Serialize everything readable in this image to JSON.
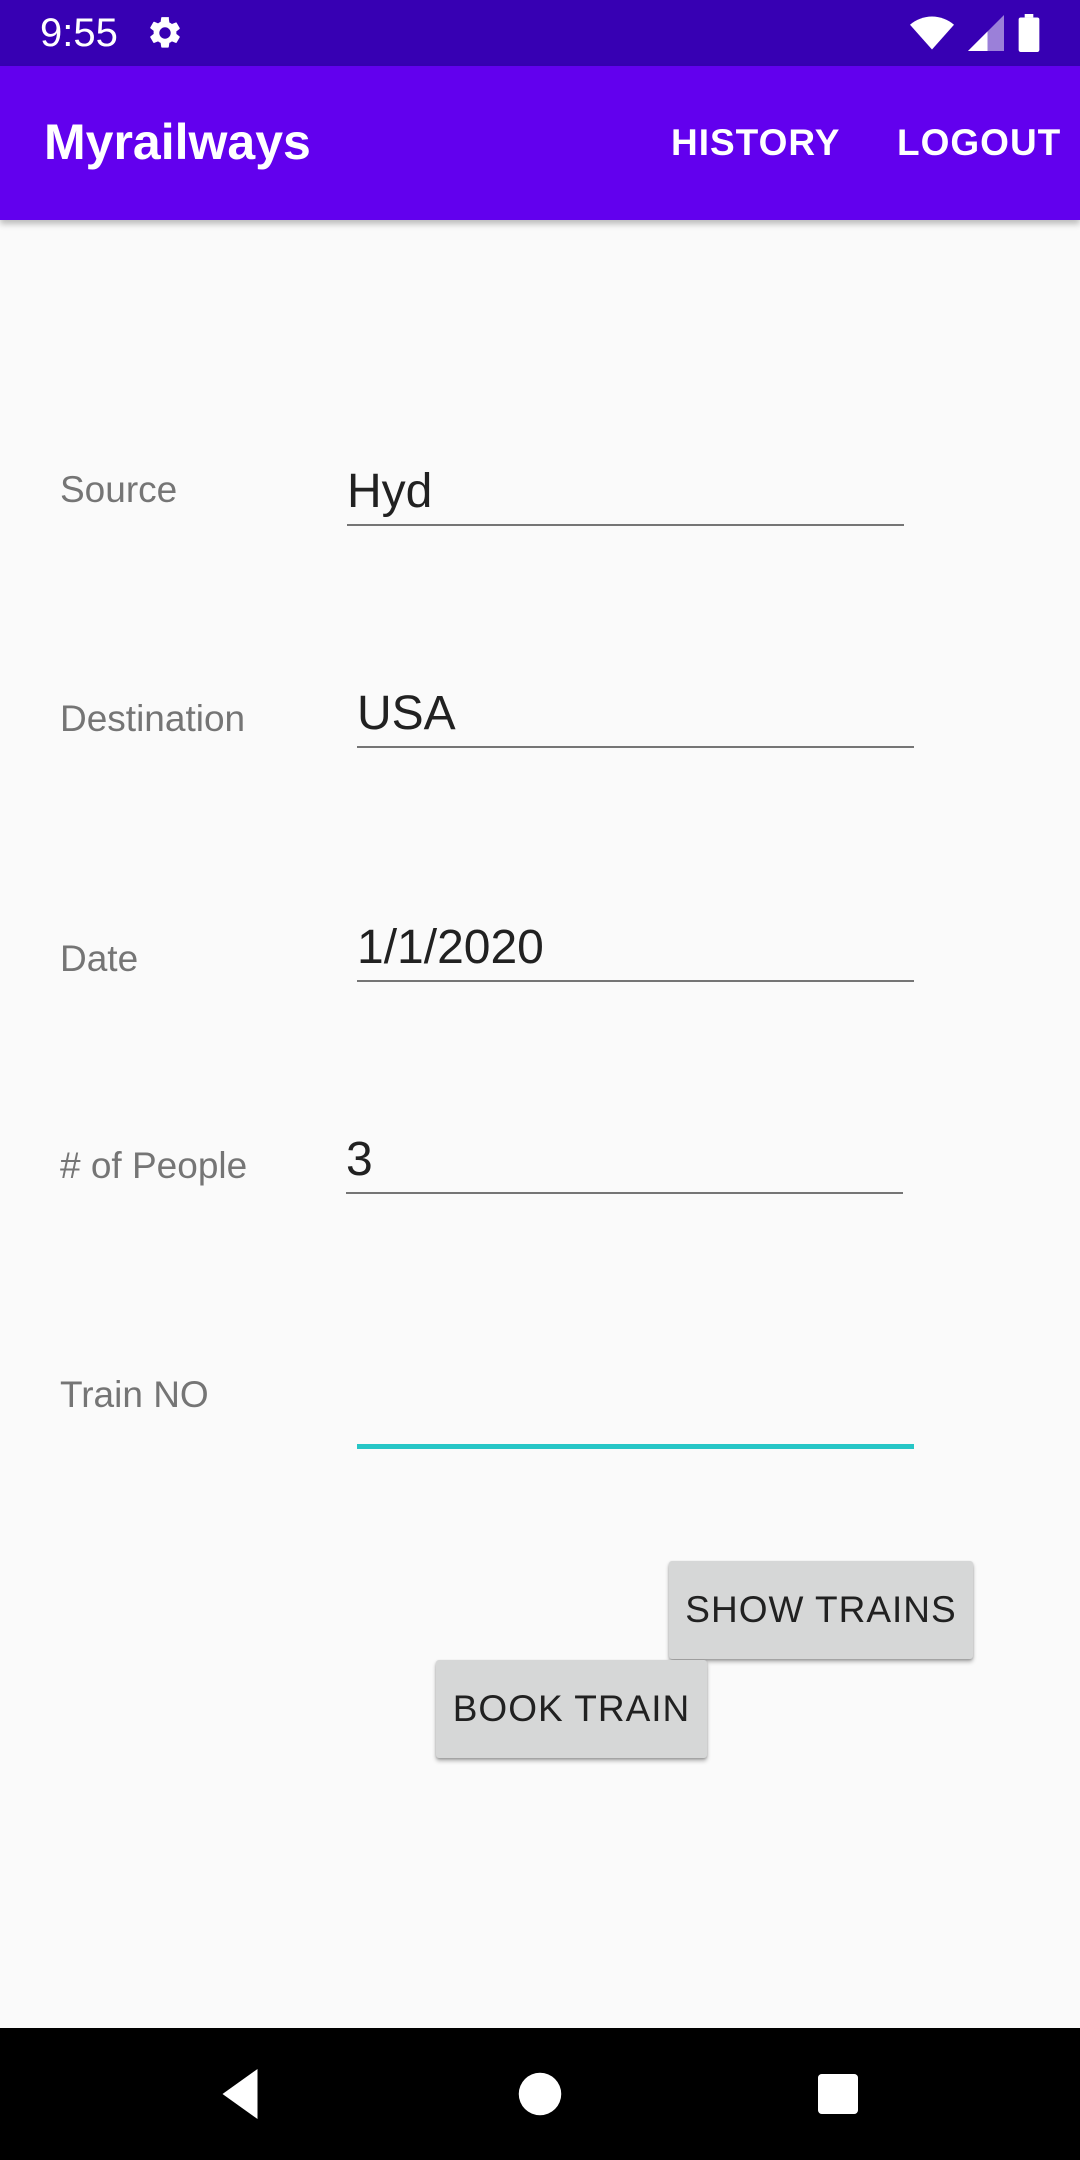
{
  "status_bar": {
    "time": "9:55",
    "icons": [
      "gear-icon",
      "wifi-icon",
      "signal-icon",
      "battery-icon"
    ]
  },
  "app_bar": {
    "title": "Myrailways",
    "actions": {
      "history": "HISTORY",
      "logout": "LOGOUT"
    }
  },
  "form": {
    "source": {
      "label": "Source",
      "value": "Hyd"
    },
    "destination": {
      "label": "Destination",
      "value": "USA"
    },
    "date": {
      "label": "Date",
      "value": "1/1/2020"
    },
    "people": {
      "label": "# of People",
      "value": "3"
    },
    "train_no": {
      "label": "Train NO",
      "value": ""
    }
  },
  "buttons": {
    "show_trains": "SHOW TRAINS",
    "book_train": "BOOK TRAIN"
  },
  "nav_bar": {
    "icons": [
      "back-icon",
      "home-icon",
      "recents-icon"
    ]
  },
  "colors": {
    "status_bar": "#3700b3",
    "app_bar": "#6200ee",
    "focus_accent": "#26c6c6",
    "button": "#d6d7d7",
    "background": "#fafafa"
  }
}
